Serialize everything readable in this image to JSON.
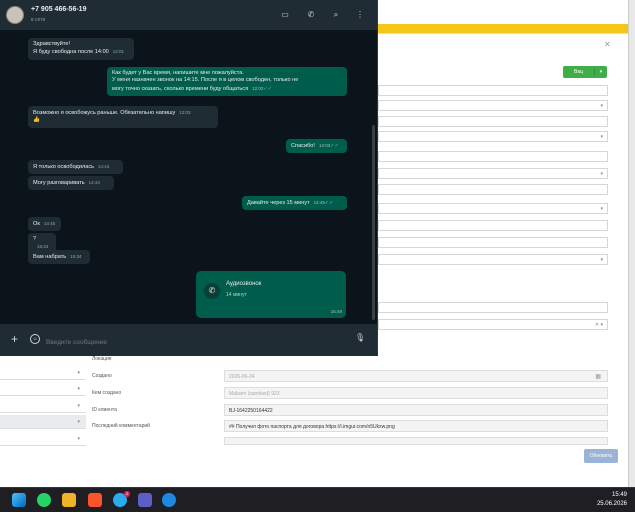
{
  "whatsapp": {
    "contact_phone": "+7 905 466-56-19",
    "contact_status": "в сети",
    "messages": [
      {
        "dir": "in",
        "lines": [
          "Здравствуйте!",
          "Я буду свободна после 14:00"
        ],
        "time": "12:01"
      },
      {
        "dir": "out",
        "lines": [
          "Как будет у Вас время, напишите мне пожалуйста.",
          "У меня назначен звонок на 14:15. После я в целом свободен, только не",
          "могу точно сказать, сколько времени буду общаться"
        ],
        "time": "12:02"
      },
      {
        "dir": "in",
        "lines": [
          "Возможно я освобожусь раньше. Обязательно напишу",
          "👍"
        ],
        "time": "12:03"
      },
      {
        "dir": "out",
        "lines": [
          "Спасибо!"
        ],
        "time": "12:03"
      },
      {
        "dir": "in",
        "lines": [
          "Я только освободилась"
        ],
        "time": "14:44"
      },
      {
        "dir": "in",
        "lines": [
          "Могу разговаривать"
        ],
        "time": "14:44"
      },
      {
        "dir": "out",
        "lines": [
          "Давайте через 15 минут"
        ],
        "time": "14:45"
      },
      {
        "dir": "in",
        "lines": [
          "Ок"
        ],
        "time": "14:45"
      },
      {
        "dir": "in",
        "lines": [
          "?"
        ],
        "time": "15:34"
      },
      {
        "dir": "in",
        "lines": [
          "Вам набрать"
        ],
        "time": "15:34"
      }
    ],
    "call": {
      "title": "Аудиозвонок",
      "duration": "14 минут",
      "time": "15:49"
    },
    "input_placeholder": "Введите сообщение",
    "colors": {
      "header": "#202c33",
      "chat_bg": "#0b141a",
      "incoming": "#202c33",
      "outgoing": "#005c4b"
    }
  },
  "crm": {
    "green_button_label": "Вац",
    "fields": [
      {
        "label": "Локация",
        "value": ""
      },
      {
        "label": "Создано",
        "value": "2026-06-24"
      },
      {
        "label": "Кем создано",
        "value": "Maksim (samleed) 923"
      },
      {
        "label": "ID клиента",
        "value": "BJ-1642250164422"
      },
      {
        "label": "Последний комментарий",
        "value": "## Получил фото паспорта для договора https://i.imgur.com/n5Ukxw.png"
      }
    ],
    "update_button": "Обновить",
    "accent_color": "#f5c518"
  },
  "taskbar": {
    "time": "15:49",
    "date": "25.06.2026",
    "telegram_badge": "2"
  }
}
